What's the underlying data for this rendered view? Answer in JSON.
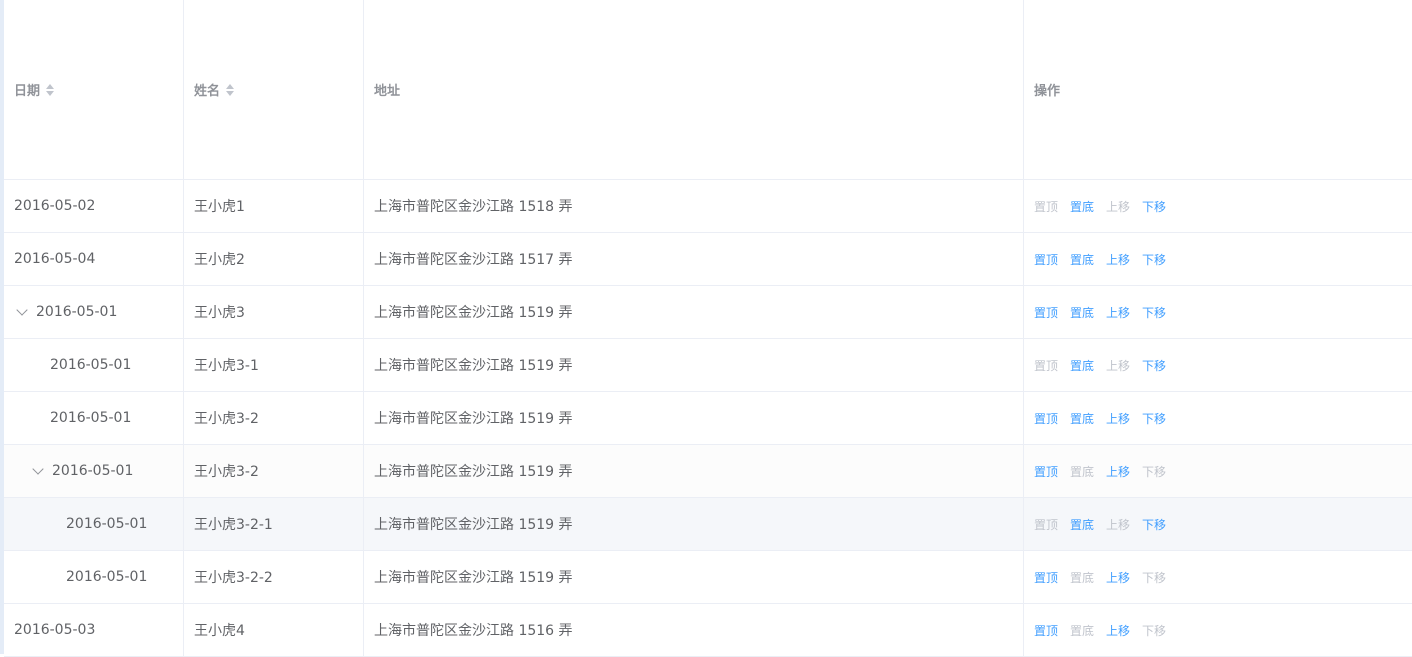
{
  "header": {
    "date": "日期",
    "name": "姓名",
    "address": "地址",
    "ops": "操作"
  },
  "rows": [
    {
      "date": "2016-05-02",
      "name": "王小虎1",
      "address": "上海市普陀区金沙江路 1518 弄",
      "ops": [
        {
          "label": "置顶",
          "enabled": false
        },
        {
          "label": "置底",
          "enabled": true
        },
        {
          "label": "上移",
          "enabled": false
        },
        {
          "label": "下移",
          "enabled": true
        }
      ]
    },
    {
      "date": "2016-05-04",
      "name": "王小虎2",
      "address": "上海市普陀区金沙江路 1517 弄",
      "ops": [
        {
          "label": "置顶",
          "enabled": true
        },
        {
          "label": "置底",
          "enabled": true
        },
        {
          "label": "上移",
          "enabled": true
        },
        {
          "label": "下移",
          "enabled": true
        }
      ]
    },
    {
      "date": "2016-05-01",
      "name": "王小虎3",
      "address": "上海市普陀区金沙江路 1519 弄",
      "ops": [
        {
          "label": "置顶",
          "enabled": true
        },
        {
          "label": "置底",
          "enabled": true
        },
        {
          "label": "上移",
          "enabled": true
        },
        {
          "label": "下移",
          "enabled": true
        }
      ]
    },
    {
      "date": "2016-05-01",
      "name": "王小虎3-1",
      "address": "上海市普陀区金沙江路 1519 弄",
      "ops": [
        {
          "label": "置顶",
          "enabled": false
        },
        {
          "label": "置底",
          "enabled": true
        },
        {
          "label": "上移",
          "enabled": false
        },
        {
          "label": "下移",
          "enabled": true
        }
      ]
    },
    {
      "date": "2016-05-01",
      "name": "王小虎3-2",
      "address": "上海市普陀区金沙江路 1519 弄",
      "ops": [
        {
          "label": "置顶",
          "enabled": true
        },
        {
          "label": "置底",
          "enabled": true
        },
        {
          "label": "上移",
          "enabled": true
        },
        {
          "label": "下移",
          "enabled": true
        }
      ]
    },
    {
      "date": "2016-05-01",
      "name": "王小虎3-2",
      "address": "上海市普陀区金沙江路 1519 弄",
      "ops": [
        {
          "label": "置顶",
          "enabled": true
        },
        {
          "label": "置底",
          "enabled": false
        },
        {
          "label": "上移",
          "enabled": true
        },
        {
          "label": "下移",
          "enabled": false
        }
      ]
    },
    {
      "date": "2016-05-01",
      "name": "王小虎3-2-1",
      "address": "上海市普陀区金沙江路 1519 弄",
      "ops": [
        {
          "label": "置顶",
          "enabled": false
        },
        {
          "label": "置底",
          "enabled": true
        },
        {
          "label": "上移",
          "enabled": false
        },
        {
          "label": "下移",
          "enabled": true
        }
      ]
    },
    {
      "date": "2016-05-01",
      "name": "王小虎3-2-2",
      "address": "上海市普陀区金沙江路 1519 弄",
      "ops": [
        {
          "label": "置顶",
          "enabled": true
        },
        {
          "label": "置底",
          "enabled": false
        },
        {
          "label": "上移",
          "enabled": true
        },
        {
          "label": "下移",
          "enabled": false
        }
      ]
    },
    {
      "date": "2016-05-03",
      "name": "王小虎4",
      "address": "上海市普陀区金沙江路 1516 弄",
      "ops": [
        {
          "label": "置顶",
          "enabled": true
        },
        {
          "label": "置底",
          "enabled": false
        },
        {
          "label": "上移",
          "enabled": true
        },
        {
          "label": "下移",
          "enabled": false
        }
      ]
    }
  ],
  "colors": {
    "link": "#409eff",
    "disabled": "#c0c4cc",
    "text": "#606266",
    "header_text": "#909399",
    "border": "#ebeef5"
  }
}
